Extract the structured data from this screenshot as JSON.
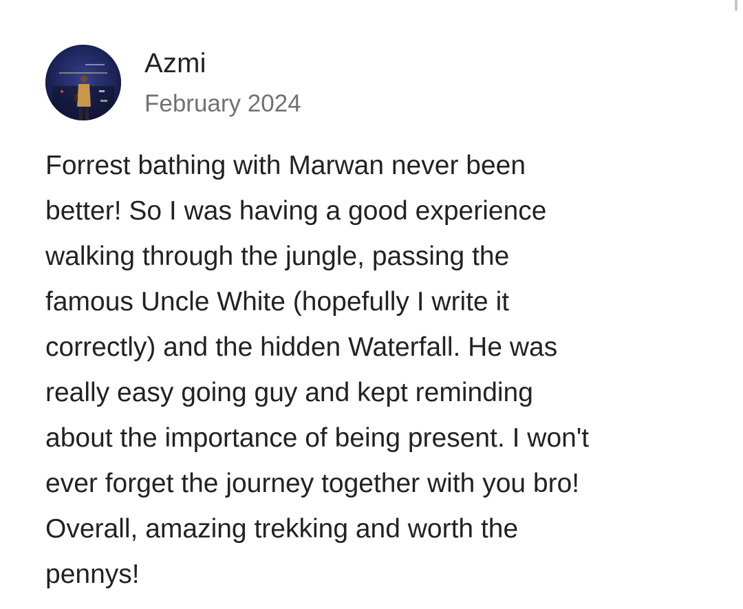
{
  "review": {
    "reviewer_name": "Azmi",
    "date": "February 2024",
    "avatar_icon": "reviewer-avatar-photo",
    "text_lines": [
      "Forrest bathing with Marwan never been",
      "better! So I was having a good experience",
      "walking through the jungle, passing the",
      "famous Uncle White (hopefully I write it",
      "correctly) and the hidden Waterfall. He was",
      "really easy going guy and kept reminding",
      "about the importance of being present. I won't",
      "ever forget the journey together with you bro!",
      "Overall, amazing trekking and worth the",
      "pennys!"
    ]
  },
  "colors": {
    "text_primary": "#222222",
    "text_secondary": "#717171",
    "background": "#ffffff"
  }
}
